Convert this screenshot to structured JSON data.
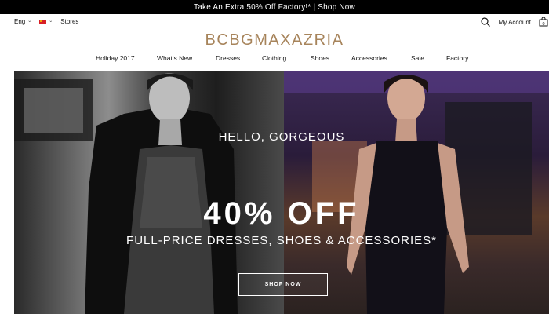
{
  "promo_bar": {
    "text": "Take An Extra 50% Off Factory!* | Shop Now"
  },
  "utility": {
    "language": "Eng",
    "stores": "Stores",
    "account": "My Account",
    "cart_count": "0"
  },
  "brand": {
    "logo": "BCBGMAXAZRIA",
    "logo_color": "#a7845b"
  },
  "nav": {
    "items": [
      {
        "label": "Holiday 2017"
      },
      {
        "label": "What's New"
      },
      {
        "label": "Dresses"
      },
      {
        "label": "Clothing"
      },
      {
        "label": "Shoes"
      },
      {
        "label": "Accessories"
      },
      {
        "label": "Sale"
      },
      {
        "label": "Factory"
      }
    ]
  },
  "hero": {
    "greeting": "HELLO, GORGEOUS",
    "headline": "40% OFF",
    "subline": "FULL-PRICE DRESSES, SHOES & ACCESSORIES*",
    "cta": "SHOP NOW"
  },
  "icons": {
    "search": "search-icon",
    "cart": "shopping-bag-icon",
    "flag": "flag-icon",
    "chevron": "chevron-down-icon"
  }
}
